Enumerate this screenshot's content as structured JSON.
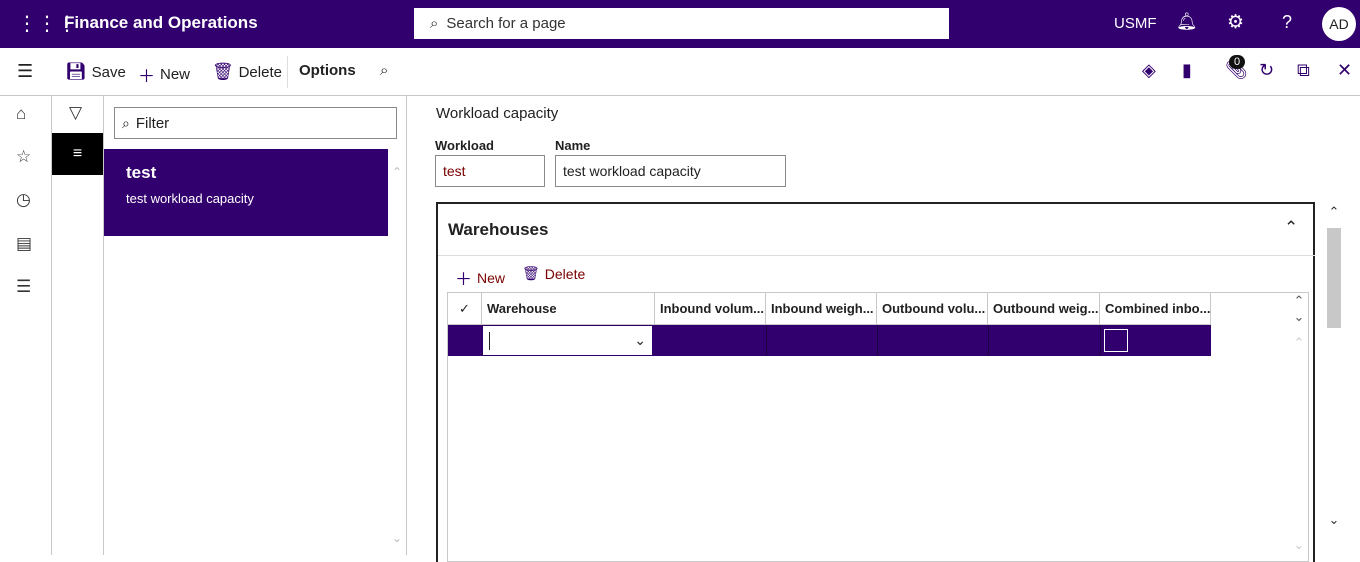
{
  "topbar": {
    "app_title": "Finance and Operations",
    "search_placeholder": "Search for a page",
    "company": "USMF",
    "avatar": "AD"
  },
  "actionbar": {
    "save": "Save",
    "new": "New",
    "delete": "Delete",
    "options": "Options",
    "attachments_count": "0"
  },
  "list": {
    "filter_placeholder": "Filter",
    "items": [
      {
        "title": "test",
        "subtitle": "test workload capacity"
      }
    ]
  },
  "form": {
    "title": "Workload capacity",
    "workload_label": "Workload",
    "workload_value": "test",
    "name_label": "Name",
    "name_value": "test workload capacity"
  },
  "warehouses": {
    "title": "Warehouses",
    "new": "New",
    "delete": "Delete",
    "columns": [
      "Warehouse",
      "Inbound volum...",
      "Inbound weigh...",
      "Outbound volu...",
      "Outbound weig...",
      "Combined inbo..."
    ],
    "rows": [
      {
        "warehouse": "",
        "combined": false
      }
    ]
  },
  "colors": {
    "brand": "#32006e"
  }
}
